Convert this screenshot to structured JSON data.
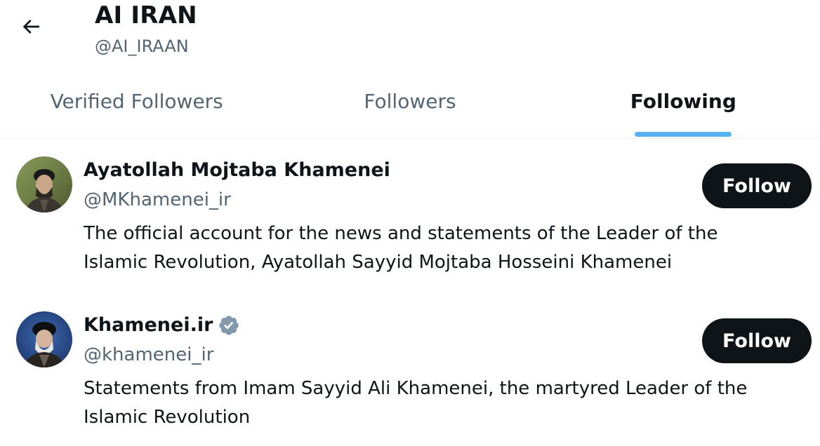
{
  "header": {
    "title": "AI IRAN",
    "handle": "@AI_IRAAN",
    "back_icon": "arrow-left-icon"
  },
  "tabs": [
    {
      "label": "Verified Followers",
      "active": false
    },
    {
      "label": "Followers",
      "active": false
    },
    {
      "label": "Following",
      "active": true
    }
  ],
  "users": [
    {
      "name": "Ayatollah Mojtaba Khamenei",
      "handle": "@MKhamenei_ir",
      "verified": false,
      "bio": "The official account for the news and statements of the Leader of the Islamic Revolution, Ayatollah Sayyid Mojtaba Hosseini Khamenei",
      "follow_label": "Follow"
    },
    {
      "name": "Khamenei.ir",
      "handle": "@khamenei_ir",
      "verified": true,
      "bio": "Statements from Imam Sayyid Ali Khamenei, the martyred Leader of the Islamic Revolution",
      "follow_label": "Follow"
    }
  ],
  "colors": {
    "text_primary": "#0f1419",
    "text_secondary": "#536471",
    "accent": "#1d9bf0",
    "button_bg": "#0f1419",
    "badge": "#829aab"
  }
}
